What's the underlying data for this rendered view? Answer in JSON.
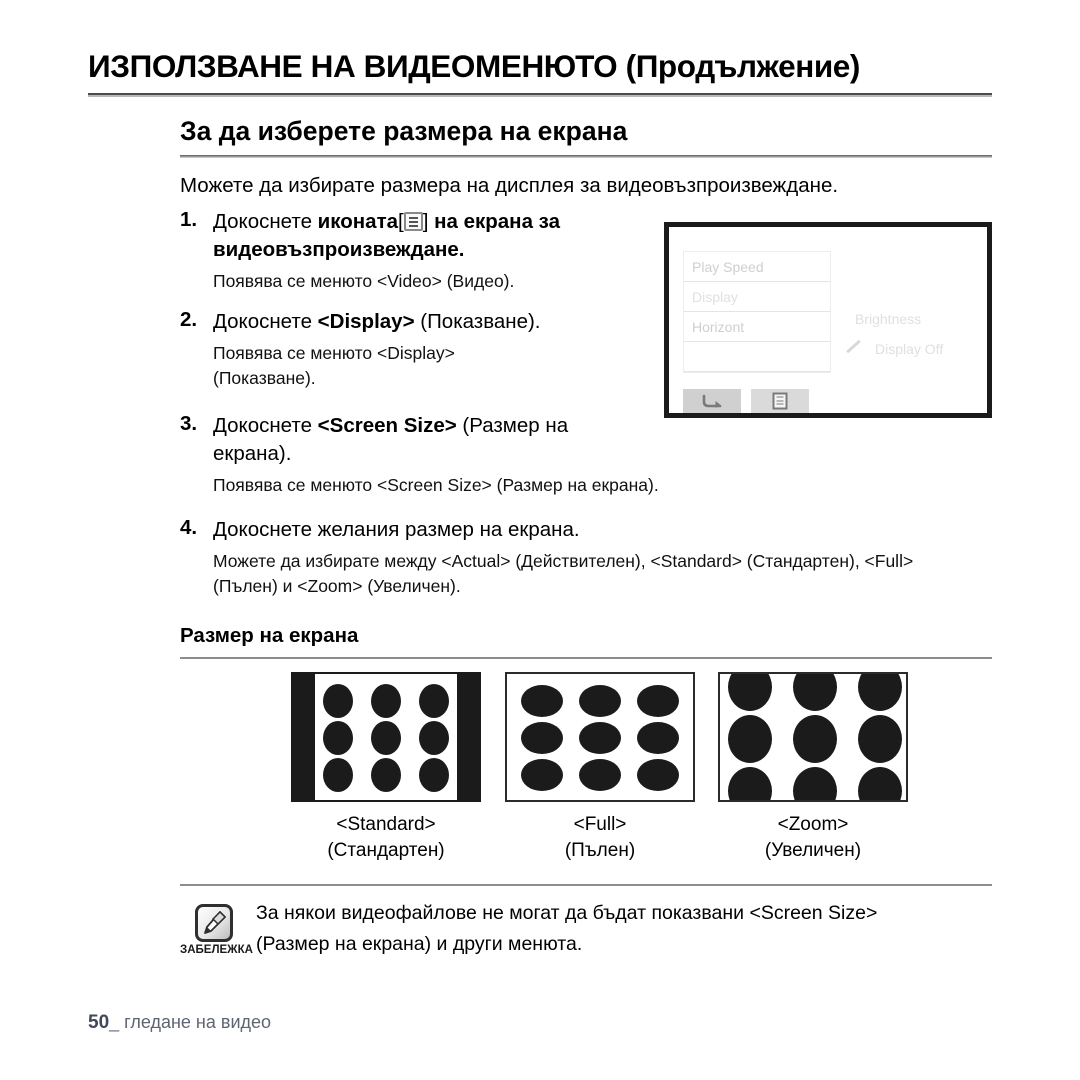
{
  "chapter": {
    "title": "ИЗПОЛЗВАНЕ НА ВИДЕОМЕНЮТО (Продължение)"
  },
  "section": {
    "heading": "За да изберете размера на екрана",
    "intro": "Можете да избирате размера на дисплея за видеовъзпроизвеждане."
  },
  "steps": [
    {
      "num": "1.",
      "text_before": "Докоснете ",
      "bold": "иконата",
      "icon": "menu-icon",
      "text_after": " на екрана за видеовъзпроизвеждане.",
      "bracket_open": "[",
      "bracket_close": "]",
      "sub": "Появява се менюто <Video> (Видео)."
    },
    {
      "num": "2.",
      "text_before": "Докоснете ",
      "bold": "<Display>",
      "text_after": " (Показване).",
      "sub": "Появява се менюто <Display> (Показване)."
    },
    {
      "num": "3.",
      "text_before": "Докоснете ",
      "bold": "<Screen Size>",
      "text_after": " (Размер на екрана).",
      "sub": "Появява се менюто <Screen Size> (Размер на екрана)."
    },
    {
      "num": "4.",
      "text_before": "Докоснете желания размер на екрана.",
      "bold": "",
      "text_after": "",
      "sub": "Можете да избирате между <Actual> (Действителен), <Standard> (Стандартен), <Full> (Пълен) и <Zoom> (Увеличен)."
    }
  ],
  "lcd": {
    "menu_items": [
      "Play Speed",
      "Display",
      "Horizont",
      ""
    ],
    "right_labels": {
      "brightness": "Brightness",
      "display_off": "Display Off"
    },
    "buttons": {
      "back": "back-arrow-icon",
      "menu": "menu-icon"
    }
  },
  "screen_size": {
    "heading": "Размер на екрана",
    "options": [
      {
        "name": "<Standard>",
        "translation": "(Стандартен)",
        "mode": "standard"
      },
      {
        "name": "<Full>",
        "translation": "(Пълен)",
        "mode": "full"
      },
      {
        "name": "<Zoom>",
        "translation": "(Увеличен)",
        "mode": "zoom"
      }
    ]
  },
  "note": {
    "label": "ЗАБЕЛЕЖКА",
    "icon": "note-pencil-icon",
    "line1": "За някои видеофайлове не могат да бъдат показвани <Screen Size>",
    "line2": "(Размер на екрана) и други менюта."
  },
  "footer": {
    "page_number": "50",
    "separator": "_",
    "label": "гледане на видео"
  },
  "colors": {
    "text": "#000000",
    "rule": "#8d8d8d",
    "footer": "#5e6472",
    "lcd_border": "#1b1b1b",
    "lcd_menu_text": "#cfcfcf"
  }
}
